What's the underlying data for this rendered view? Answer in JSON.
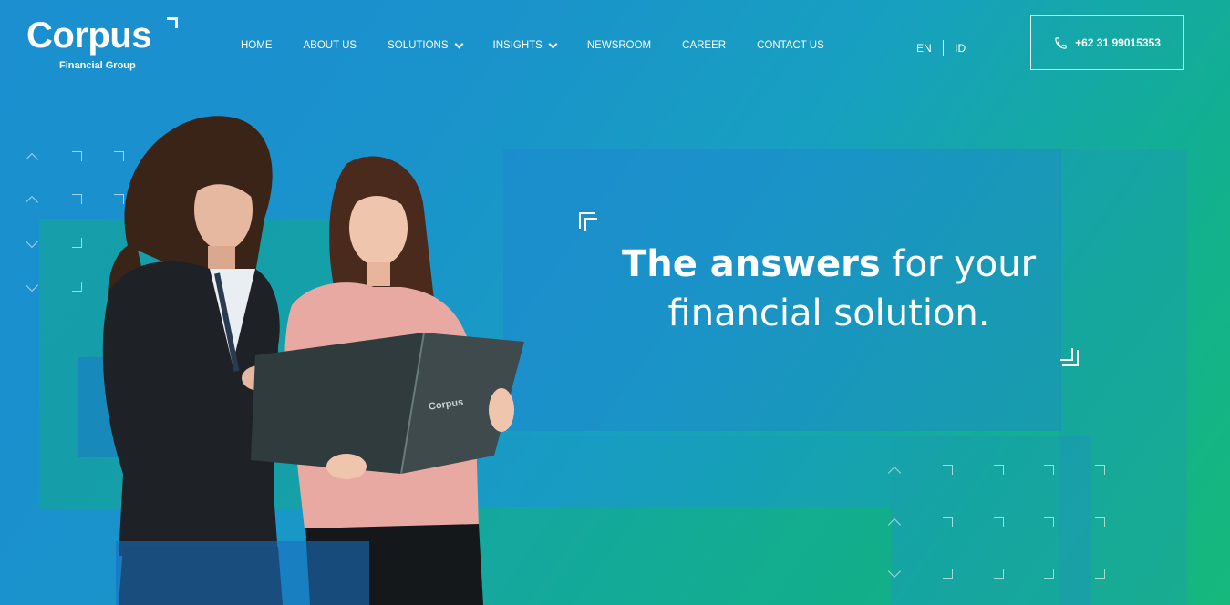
{
  "brand": {
    "name": "Corpus",
    "sub": "Financial Group"
  },
  "nav": [
    {
      "label": "HOME",
      "dropdown": false
    },
    {
      "label": "ABOUT US",
      "dropdown": false
    },
    {
      "label": "SOLUTIONS",
      "dropdown": true
    },
    {
      "label": "INSIGHTS",
      "dropdown": true
    },
    {
      "label": "NEWSROOM",
      "dropdown": false
    },
    {
      "label": "CAREER",
      "dropdown": false
    },
    {
      "label": "CONTACT US",
      "dropdown": false
    }
  ],
  "lang": {
    "en": "EN",
    "id": "ID"
  },
  "phone": {
    "number": "+62 31 99015353",
    "icon": "phone-icon"
  },
  "hero": {
    "bold": "The answers",
    "rest": " for your",
    "line2": "financial solution."
  },
  "folder_brand": "Corpus",
  "colors": {
    "gradient_start": "#1b8fd0",
    "gradient_end": "#17b87c",
    "text": "#ffffff"
  }
}
